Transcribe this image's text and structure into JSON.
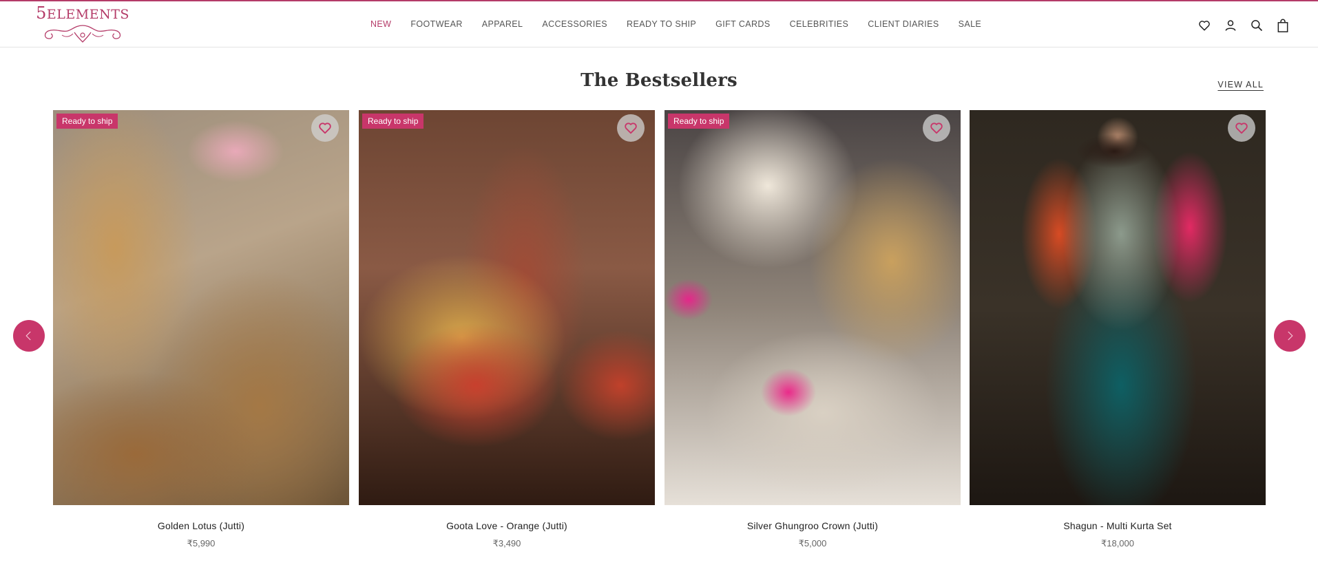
{
  "brand": {
    "logo_text_prefix": "5",
    "logo_text_rest": "ELEMENTS",
    "accent_color": "#b43b68"
  },
  "nav": {
    "items": [
      {
        "label": "NEW",
        "active": true
      },
      {
        "label": "FOOTWEAR"
      },
      {
        "label": "APPAREL"
      },
      {
        "label": "ACCESSORIES"
      },
      {
        "label": "READY TO SHIP"
      },
      {
        "label": "GIFT CARDS"
      },
      {
        "label": "CELEBRITIES"
      },
      {
        "label": "CLIENT DIARIES"
      },
      {
        "label": "SALE"
      }
    ]
  },
  "header_icons": [
    "wishlist-heart-icon",
    "account-user-icon",
    "search-icon",
    "shopping-bag-icon"
  ],
  "section": {
    "title": "The Bestsellers",
    "view_all": "VIEW ALL"
  },
  "products": [
    {
      "name": "Golden Lotus (Jutti)",
      "price": "₹5,990",
      "badge": "Ready to ship"
    },
    {
      "name": "Goota Love - Orange (Jutti)",
      "price": "₹3,490",
      "badge": "Ready to ship"
    },
    {
      "name": "Silver Ghungroo Crown (Jutti)",
      "price": "₹5,000",
      "badge": "Ready to ship"
    },
    {
      "name": "Shagun - Multi Kurta Set",
      "price": "₹18,000",
      "badge": ""
    }
  ],
  "carousel": {
    "prev_icon": "chevron-left-icon",
    "next_icon": "chevron-right-icon"
  }
}
